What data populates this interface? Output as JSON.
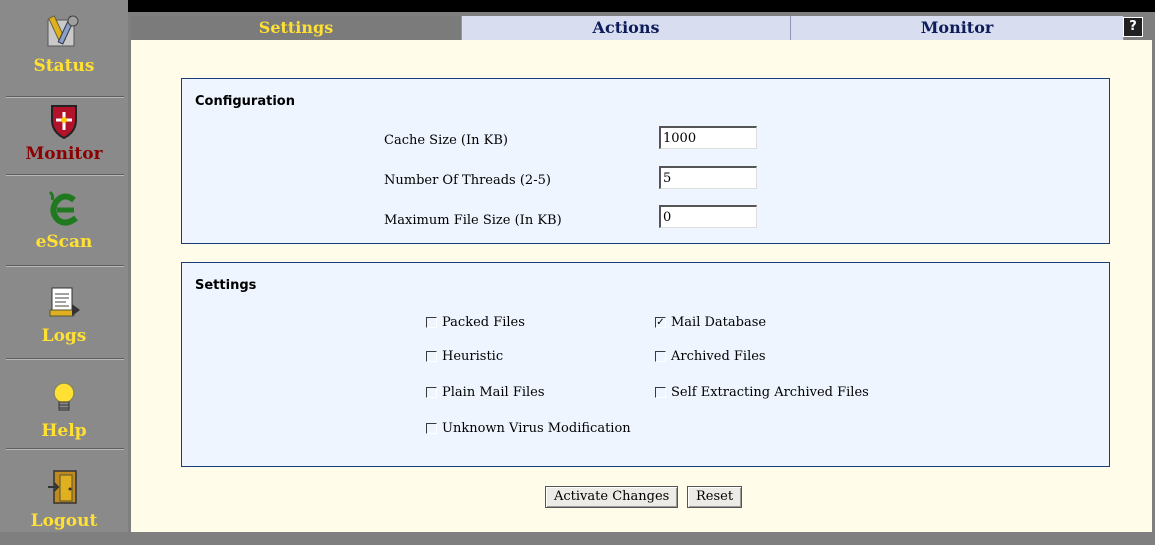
{
  "sidebar": {
    "items": [
      {
        "label": "Status",
        "icon": "tools-icon"
      },
      {
        "label": "Monitor",
        "icon": "shield-icon"
      },
      {
        "label": "eScan",
        "icon": "escan-logo-icon"
      },
      {
        "label": "Logs",
        "icon": "document-icon"
      },
      {
        "label": "Help",
        "icon": "lightbulb-icon"
      },
      {
        "label": "Logout",
        "icon": "exit-door-icon"
      }
    ]
  },
  "tabs": [
    {
      "label": "Settings",
      "active": true
    },
    {
      "label": "Actions",
      "active": false
    },
    {
      "label": "Monitor",
      "active": false
    }
  ],
  "help_button": "?",
  "configuration": {
    "title": "Configuration",
    "fields": [
      {
        "label": "Cache Size (In KB)",
        "value": "1000"
      },
      {
        "label": "Number Of Threads (2-5)",
        "value": "5"
      },
      {
        "label": "Maximum File Size (In KB)",
        "value": "0"
      }
    ]
  },
  "settings": {
    "title": "Settings",
    "options": [
      {
        "label": "Packed Files",
        "checked": false
      },
      {
        "label": "Mail Database",
        "checked": true
      },
      {
        "label": "Heuristic",
        "checked": false
      },
      {
        "label": "Archived Files",
        "checked": false
      },
      {
        "label": "Plain Mail Files",
        "checked": false
      },
      {
        "label": "Self Extracting Archived Files",
        "checked": false
      },
      {
        "label": "Unknown Virus Modification",
        "checked": false
      }
    ]
  },
  "buttons": {
    "activate": "Activate Changes",
    "reset": "Reset"
  },
  "colors": {
    "sidebar_label": "#ffe033",
    "active_sidebar_label": "#8b0000",
    "panel_bg": "#fffde9",
    "box_bg": "#eef5ff",
    "box_border": "#1d3b7a",
    "tab_bg": "#d8ddef",
    "active_tab_bg": "#7b7b7b"
  }
}
